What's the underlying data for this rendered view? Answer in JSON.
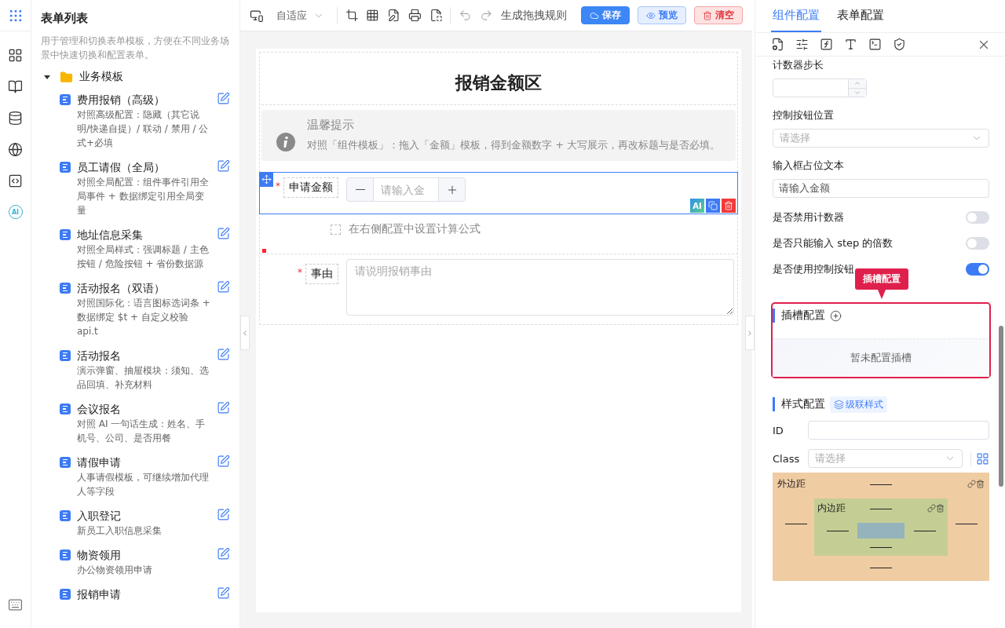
{
  "rail": {
    "ai_label": "AI"
  },
  "list_panel": {
    "title": "表单列表",
    "description": "用于管理和切换表单模板，方便在不同业务场景中快速切换和配置表单。",
    "folder": {
      "label": "业务模板",
      "expanded": true,
      "children": [
        {
          "title": "费用报销（高级）",
          "desc": "对照高级配置：隐藏（其它说明/快递自提）/ 联动 / 禁用 / 公式+必填"
        },
        {
          "title": "员工请假（全局）",
          "desc": "对照全局配置：组件事件引用全局事件 + 数据绑定引用全局变量"
        },
        {
          "title": "地址信息采集",
          "desc": "对照全局样式：强调标题 / 主色按钮 / 危险按钮 + 省份数据源"
        },
        {
          "title": "活动报名（双语）",
          "desc": "对照国际化：语言图标选词条 + 数据绑定 $t + 自定义校验 api.t"
        },
        {
          "title": "活动报名",
          "desc": "演示弹窗、抽屉模块：须知、选品回填、补充材料"
        },
        {
          "title": "会议报名",
          "desc": "对照 AI 一句话生成：姓名、手机号、公司、是否用餐"
        },
        {
          "title": "请假申请",
          "desc": "人事请假模板，可继续增加代理人等字段"
        },
        {
          "title": "入职登记",
          "desc": "新员工入职信息采集"
        },
        {
          "title": "物资领用",
          "desc": "办公物资领用申请"
        },
        {
          "title": "报销申请"
        }
      ]
    }
  },
  "toolbar": {
    "layout_select": "自适应",
    "rule_button": "生成拖拽规则",
    "buttons": [
      {
        "label": "保存",
        "kind": "primary"
      },
      {
        "label": "预览",
        "kind": "info"
      },
      {
        "label": "清空",
        "kind": "danger"
      }
    ]
  },
  "canvas": {
    "title": "报销金额区",
    "alert": {
      "title": "温馨提示",
      "text": "对照「组件模板」：拖入「金额」模板，得到金额数字 + 大写展示，再改标题与是否必填。"
    },
    "fields": [
      {
        "kind": "number",
        "label": "申请金额",
        "required_mark": "*",
        "selected": true,
        "placeholder": "请输入金",
        "action_label": "AI"
      },
      {
        "kind": "hint",
        "text": "在右侧配置中设置计算公式",
        "selected": false
      },
      {
        "kind": "textarea",
        "label": "事由",
        "required_mark": "*",
        "selected": false,
        "placeholder": "请说明报销事由"
      }
    ]
  },
  "config_panel": {
    "tabs": [
      {
        "label": "组件配置",
        "selected": true
      },
      {
        "label": "表单配置",
        "selected": false
      }
    ],
    "fields": [
      {
        "kind": "number",
        "label": "计数器步长"
      },
      {
        "kind": "select",
        "label": "控制按钮位置",
        "placeholder": "请选择"
      },
      {
        "kind": "text",
        "label": "输入框占位文本",
        "value": "请输入金额"
      },
      {
        "kind": "switch",
        "label": "是否禁用计数器",
        "on": false
      },
      {
        "kind": "switch",
        "label": "是否只能输入 step 的倍数",
        "on": false
      },
      {
        "kind": "switch",
        "label": "是否使用控制按钮",
        "on": true
      }
    ],
    "slot": {
      "title": "插槽配置",
      "empty_text": "暂未配置插槽",
      "highlighted": true,
      "tooltip": "插槽配置"
    },
    "style": {
      "title": "样式配置",
      "cascade_button": "级联样式",
      "id_label": "ID",
      "class_label": "Class",
      "class_placeholder": "请选择",
      "margin_label": "外边距",
      "padding_label": "内边距"
    }
  }
}
